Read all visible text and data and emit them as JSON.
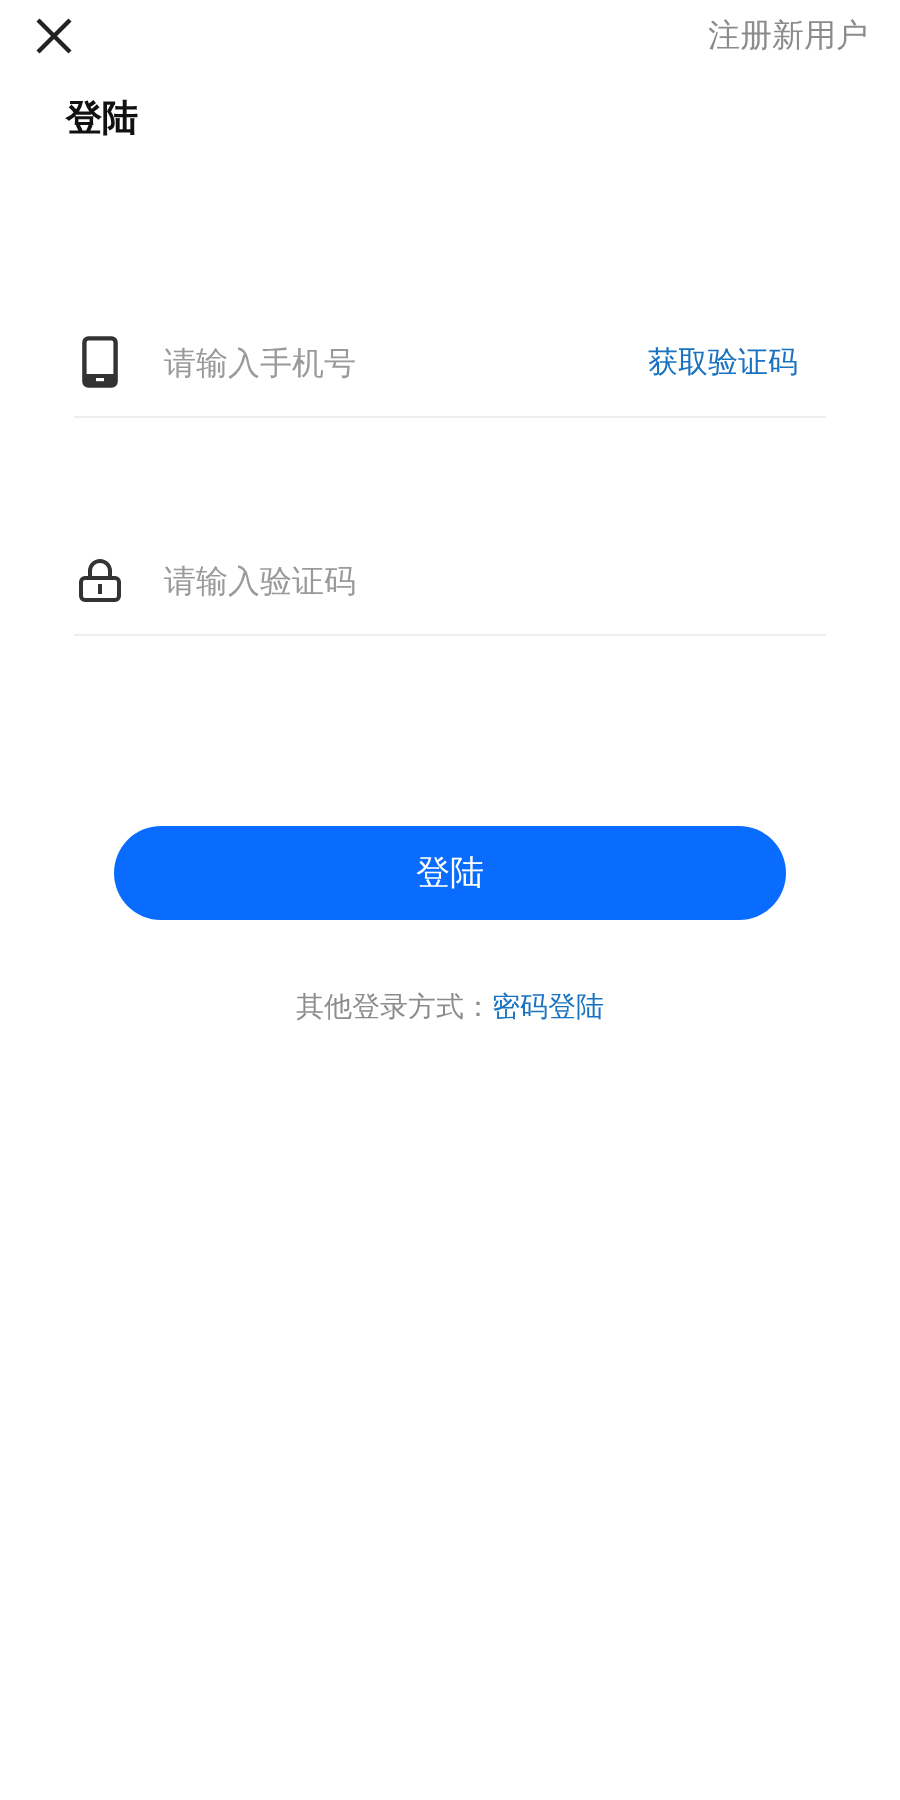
{
  "header": {
    "register_link": "注册新用户"
  },
  "title": "登陆",
  "fields": [
    {
      "kind": "phone",
      "placeholder": "请输入手机号",
      "action": "获取验证码"
    },
    {
      "kind": "code",
      "placeholder": "请输入验证码"
    }
  ],
  "login_button": "登陆",
  "alternative": {
    "label": "其他登录方式：",
    "link": "密码登陆"
  }
}
